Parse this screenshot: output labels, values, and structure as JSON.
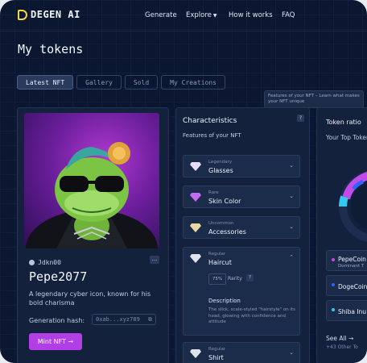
{
  "header": {
    "logo_text": "DEGEN AI",
    "nav": {
      "generate": "Generate",
      "explore": "Explore",
      "how": "How it works",
      "faq": "FAQ"
    }
  },
  "page_title": "My tokens",
  "tabs": [
    {
      "label": "Latest NFT",
      "active": true
    },
    {
      "label": "Gallery",
      "active": false
    },
    {
      "label": "Sold",
      "active": false
    },
    {
      "label": "My Creations",
      "active": false
    }
  ],
  "tooltip": "Features of your NFT – Learn what makes your NFT unique",
  "nft": {
    "owner": "Jdkn00",
    "more": "...",
    "name": "Pepe2077",
    "description": "A legendary cyber icon, known for his bold charisma",
    "hash_label": "Generation hash:",
    "hash_value": "0xab...xyz789",
    "mint_label": "Mint NFT →"
  },
  "characteristics": {
    "title": "Characteristics",
    "help": "?",
    "subtitle": "Features of your NFT",
    "traits": [
      {
        "rarity": "Legendary",
        "name": "Glasses",
        "gem_color": "#e6dcff"
      },
      {
        "rarity": "Rare",
        "name": "Skin Color",
        "gem_color": "#c26cf0"
      },
      {
        "rarity": "Uncommon",
        "name": "Accessories",
        "gem_color": "#e9d8a6"
      },
      {
        "rarity": "Regular",
        "name": "Haircut",
        "gem_color": "#dfe3ea",
        "percent": "75%",
        "rarity_label": "Rarity",
        "rarity_help": "?",
        "desc_heading": "Description",
        "desc_text": "The slick, scale-styled \"hairstyle\" on its head, glowing with confidence and attitude"
      },
      {
        "rarity": "Regular",
        "name": "Shirt",
        "gem_color": "#dfe3ea"
      }
    ]
  },
  "token_ratio": {
    "title": "Token ratio",
    "subtitle": "Your Top Token",
    "coins": [
      {
        "name": "PepeCoin",
        "sub": "Dominant T",
        "color": "#c24ae8"
      },
      {
        "name": "DogeCoin",
        "sub": "",
        "color": "#2f64ff"
      },
      {
        "name": "Shiba Inu",
        "sub": "",
        "color": "#35c8f0"
      }
    ],
    "see_all": "See All →",
    "other": "+43 Other To"
  }
}
